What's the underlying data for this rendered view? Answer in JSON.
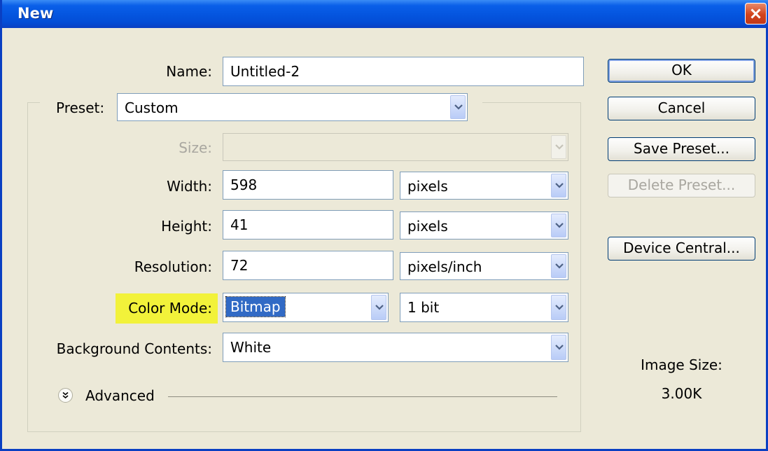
{
  "dialog": {
    "title": "New"
  },
  "form": {
    "name": {
      "label": "Name:",
      "value": "Untitled-2"
    },
    "preset": {
      "label": "Preset:",
      "value": "Custom"
    },
    "size": {
      "label": "Size:",
      "value": ""
    },
    "width": {
      "label": "Width:",
      "value": "598",
      "unit": "pixels"
    },
    "height": {
      "label": "Height:",
      "value": "41",
      "unit": "pixels"
    },
    "resolution": {
      "label": "Resolution:",
      "value": "72",
      "unit": "pixels/inch"
    },
    "color_mode": {
      "label": "Color Mode:",
      "value": "Bitmap",
      "depth": "1 bit"
    },
    "background": {
      "label": "Background Contents:",
      "value": "White"
    },
    "advanced": {
      "label": "Advanced"
    }
  },
  "buttons": {
    "ok": "OK",
    "cancel": "Cancel",
    "save_preset": "Save Preset...",
    "delete_preset": "Delete Preset...",
    "device_central": "Device Central..."
  },
  "image_size": {
    "label": "Image Size:",
    "value": "3.00K"
  },
  "colors": {
    "titlebar": "#0556e0",
    "dialog_bg": "#ece9d8",
    "highlight": "#f2f23a",
    "selection": "#316ac5"
  },
  "icons": {
    "close": "close-icon",
    "dropdown": "chevron-down-icon",
    "advanced_toggle": "double-chevron-down-icon"
  }
}
